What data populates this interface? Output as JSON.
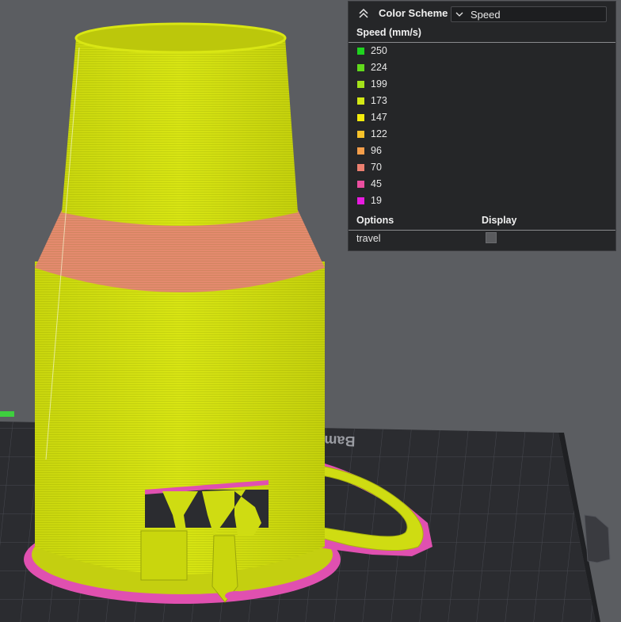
{
  "legend": {
    "color_scheme_label": "Color Scheme",
    "color_scheme_value": "Speed",
    "speed_header": "Speed (mm/s)",
    "items": [
      {
        "value": "250",
        "color": "#1fd21f"
      },
      {
        "value": "224",
        "color": "#62da1c"
      },
      {
        "value": "199",
        "color": "#a4e21a"
      },
      {
        "value": "173",
        "color": "#d3e815"
      },
      {
        "value": "147",
        "color": "#f4ec0c"
      },
      {
        "value": "122",
        "color": "#f8c22a"
      },
      {
        "value": "96",
        "color": "#f59e4a"
      },
      {
        "value": "70",
        "color": "#ec8070"
      },
      {
        "value": "45",
        "color": "#ec4fa0"
      },
      {
        "value": "19",
        "color": "#e81ce0"
      }
    ],
    "options_header": "Options",
    "display_header": "Display",
    "options": [
      {
        "label": "travel",
        "checked": false
      }
    ]
  },
  "plate": {
    "brand_text": "Bambu Textu"
  },
  "colors": {
    "model_yellow": "#d4e20f",
    "model_salmon": "#e48a6e",
    "brim_magenta": "#e050b0",
    "background": "#5b5d61",
    "plate": "#2b2c30",
    "panel": "#252628"
  }
}
